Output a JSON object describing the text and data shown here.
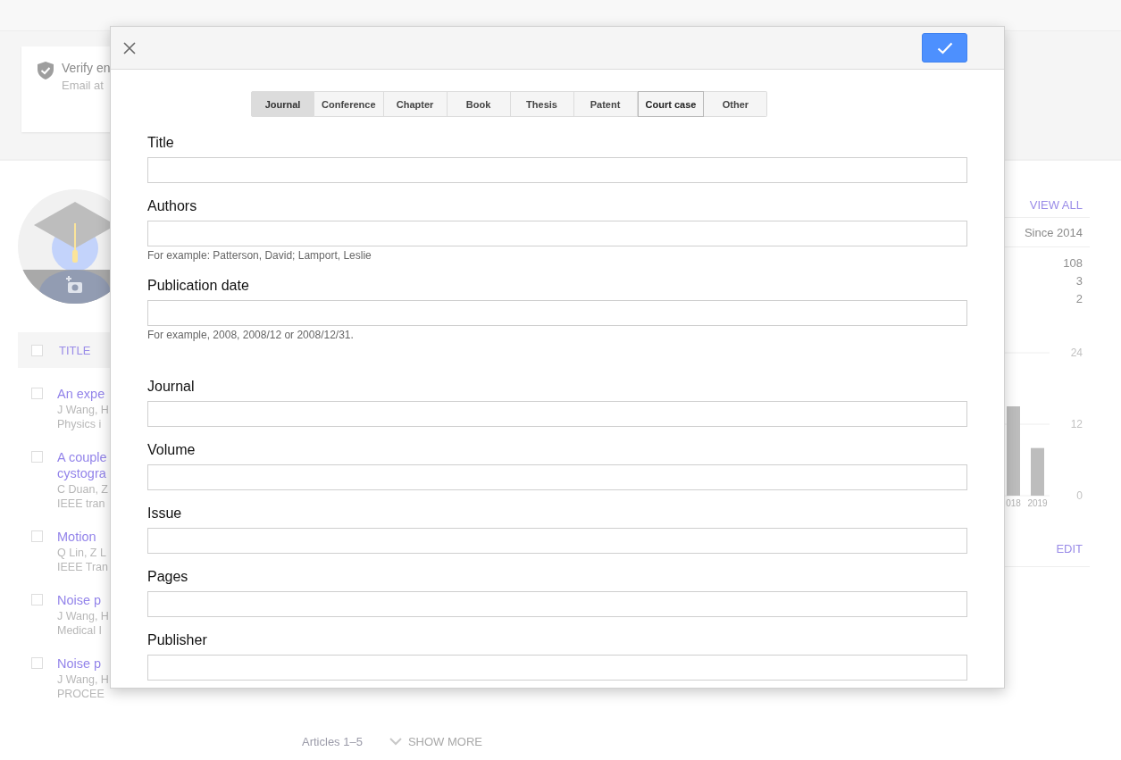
{
  "banner": {
    "title": "Verify en",
    "subtitle": "Email at"
  },
  "articles_header": {
    "checked": false,
    "label": "TITLE"
  },
  "articles": [
    {
      "checked": false,
      "title": "An expe",
      "authors": "J Wang, H",
      "venue": "Physics i"
    },
    {
      "checked": false,
      "title": "A couple cystogra",
      "authors": "C Duan, Z",
      "venue": "IEEE tran"
    },
    {
      "checked": false,
      "title": "Motion",
      "authors": "Q Lin, Z L",
      "venue": "IEEE Tran"
    },
    {
      "checked": false,
      "title": "Noise p",
      "authors": "J Wang, H",
      "venue": "Medical I"
    },
    {
      "checked": false,
      "title": "Noise p",
      "authors": "J Wang, H",
      "venue": "PROCEE"
    }
  ],
  "footer": {
    "count": "Articles 1–5",
    "show_more": "SHOW MORE"
  },
  "metrics": {
    "view_all": "VIEW ALL",
    "column": "Since 2014",
    "values": [
      "108",
      "3",
      "2"
    ],
    "chart_data": {
      "type": "bar",
      "categories": [
        "018",
        "2019"
      ],
      "values": [
        15,
        8
      ],
      "yticks": [
        0,
        12,
        24
      ],
      "ylim": [
        0,
        24
      ]
    },
    "edit": "EDIT"
  },
  "dialog": {
    "tabs": [
      {
        "label": "Journal",
        "selected": true,
        "focused": false
      },
      {
        "label": "Conference",
        "selected": false,
        "focused": false
      },
      {
        "label": "Chapter",
        "selected": false,
        "focused": false
      },
      {
        "label": "Book",
        "selected": false,
        "focused": false
      },
      {
        "label": "Thesis",
        "selected": false,
        "focused": false
      },
      {
        "label": "Patent",
        "selected": false,
        "focused": false
      },
      {
        "label": "Court case",
        "selected": false,
        "focused": true
      },
      {
        "label": "Other",
        "selected": false,
        "focused": false
      }
    ],
    "general_fields": [
      {
        "label": "Title"
      },
      {
        "label": "Authors",
        "hint": "For example: Patterson, David; Lamport, Leslie"
      },
      {
        "label": "Publication date",
        "hint": "For example, 2008, 2008/12 or 2008/12/31."
      }
    ],
    "source_fields": [
      {
        "label": "Journal"
      },
      {
        "label": "Volume"
      },
      {
        "label": "Issue"
      },
      {
        "label": "Pages"
      },
      {
        "label": "Publisher"
      }
    ]
  }
}
